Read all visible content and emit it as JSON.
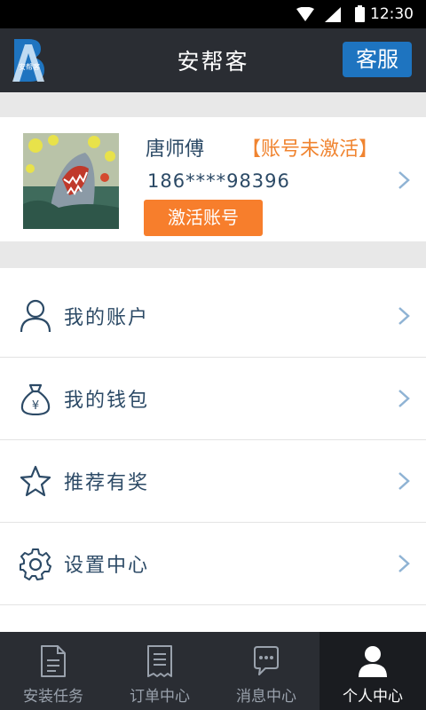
{
  "status_bar": {
    "time": "12:30"
  },
  "header": {
    "title": "安帮客",
    "service_label": "客服",
    "logo_text": "安帮客"
  },
  "profile": {
    "name": "唐师傅",
    "account_status": "【账号未激活】",
    "phone": "186****98396",
    "activate_label": "激活账号"
  },
  "menu": {
    "items": [
      {
        "label": "我的账户",
        "icon": "user-icon"
      },
      {
        "label": "我的钱包",
        "icon": "money-bag-icon"
      },
      {
        "label": "推荐有奖",
        "icon": "star-icon"
      },
      {
        "label": "设置中心",
        "icon": "gear-icon"
      }
    ]
  },
  "tabs": [
    {
      "label": "安装任务",
      "icon": "document-icon",
      "active": false
    },
    {
      "label": "订单中心",
      "icon": "receipt-icon",
      "active": false
    },
    {
      "label": "消息中心",
      "icon": "chat-bubble-icon",
      "active": false
    },
    {
      "label": "个人中心",
      "icon": "person-icon",
      "active": true
    }
  ],
  "colors": {
    "accent_blue": "#1e74c0",
    "accent_orange": "#f77e2c",
    "text_navy": "#2c4a66",
    "bar_dark": "#2a2d33"
  }
}
